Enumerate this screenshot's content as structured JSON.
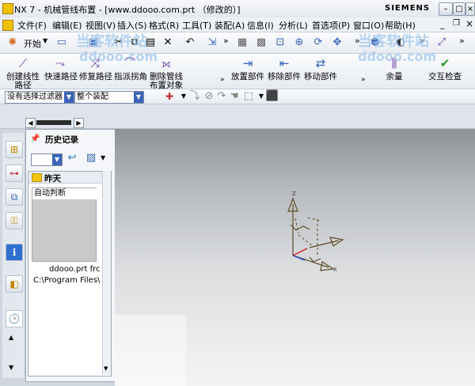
{
  "window": {
    "title": "NX 7 - 机械管线布置 - [www.ddooo.com.prt （修改的）]",
    "brand": "SIEMENS",
    "minimize": "–",
    "maximize": "□",
    "close": "×"
  },
  "menu": {
    "items": [
      "文件(F)",
      "编辑(E)",
      "视图(V)",
      "插入(S)",
      "格式(R)",
      "工具(T)",
      "装配(A)",
      "信息(I)",
      "分析(L)",
      "首选项(P)",
      "窗口(O)",
      "帮助(H)"
    ]
  },
  "toolbar1": {
    "start_label": "开始",
    "chevron": "»"
  },
  "toolbar2": {
    "commands": [
      "创建线性路径",
      "快速路径",
      "修复路径",
      "指派拐角",
      "删除管线布置对象",
      "放置部件",
      "移除部件",
      "移动部件",
      "余量",
      "交互检查"
    ],
    "create_line1": "创建线性",
    "create_line2": "路径",
    "quick_path": "快速路径",
    "repair_path": "修复路径",
    "assign_corner": "指派拐角",
    "delete_line1": "删除管线",
    "delete_line2": "布置对象",
    "place_part": "放置部件",
    "remove_part": "移除部件",
    "move_part": "移动部件",
    "stock": "余量",
    "interference": "交互检查"
  },
  "toolbar3": {
    "filter": "没有选择过滤器",
    "scope": "整个装配"
  },
  "panel": {
    "header": "历史记录",
    "group": "昨天",
    "entry": "自动判断",
    "file_name": "ddooo.prt frc",
    "file_path": "C:\\Program Files\\"
  },
  "axes": {
    "z": "Z",
    "x": "X"
  },
  "watermark": {
    "text": "当客软件站",
    "domain": "ddooo.com"
  }
}
